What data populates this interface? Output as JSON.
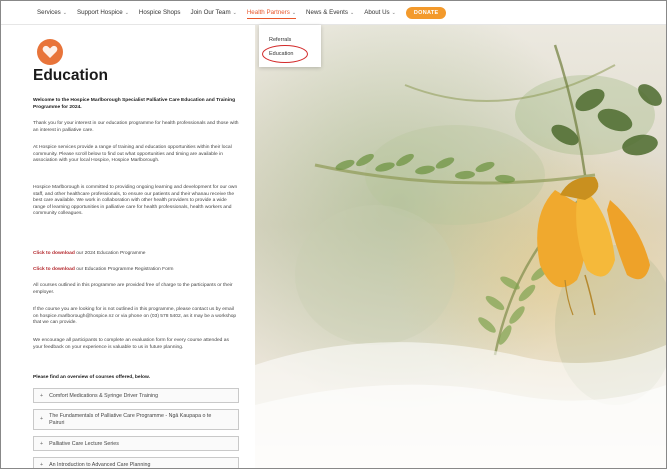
{
  "nav": {
    "items": [
      {
        "label": "Services",
        "chevron": true
      },
      {
        "label": "Support Hospice",
        "chevron": true
      },
      {
        "label": "Hospice Shops",
        "chevron": false
      },
      {
        "label": "Join Our Team",
        "chevron": true
      },
      {
        "label": "Health Partners",
        "chevron": true,
        "active": true
      },
      {
        "label": "News & Events",
        "chevron": true
      },
      {
        "label": "About Us",
        "chevron": true
      }
    ],
    "donate_label": "DONATE",
    "accent_color": "#e8572b"
  },
  "dropdown": {
    "items": [
      "Referrals",
      "Education"
    ],
    "highlighted": "Education"
  },
  "page": {
    "title": "Education",
    "intro_bold": "Welcome to the Hospice Marlborough Specialist Palliative Care Education and Training Programme for 2024.",
    "para1": "Thank you for your interest in our education programme for health professionals and those with an interest in palliative care.",
    "para2": "At Hospice services provide a range of training and education opportunities within their local community. Please scroll below to find out what opportunities and timing are available in association with your local Hospice, Hospice Marlborough.",
    "para3": "Hospice Marlborough is committed to providing ongoing learning and development for our own staff, and other healthcare professionals, to ensure our patients and their whanau receive the best care available. We work in collaboration with other health providers to provide a wide range of learning opportunities in palliative care for health professionals, health workers and community colleagues.",
    "download1_link": "Click to download",
    "download1_text": " our 2024 Education Programme",
    "download2_link": "Click to download",
    "download2_text": " our Education Programme Registration Form",
    "para4": "All courses outlined in this programme are provided free of charge to the participants or their employer.",
    "para5": "If the course you are looking for is not outlined in this programme, please contact us by email on hospice.marlborough@hospice.nz or via phone on (03) 578 5402, as it may be a workshop that we can provide.",
    "para6": "We encourage all participants to complete an evaluation form for every course attended as your feedback on your experience is valuable to us in future planning.",
    "overview_heading": "Please find an overview of courses offered, below.",
    "courses": [
      "Comfort Medications & Syringe Driver Training",
      "The Fundamentals of Palliative Care Programme - Ngā Kaupapa o te Pairuri",
      "Palliative Care Lecture Series",
      "An Introduction to Advanced Care Planning"
    ]
  },
  "icons": {
    "logo": "hospice-heart-logo",
    "accordion": "plus-icon",
    "nav_chevron": "chevron-down-icon"
  }
}
